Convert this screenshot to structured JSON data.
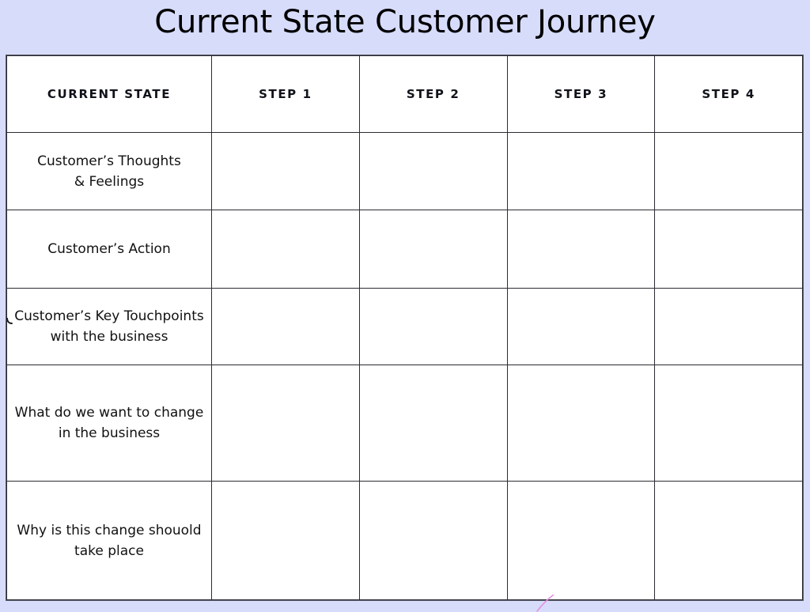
{
  "page": {
    "title": "Current State Customer Journey",
    "background_color": "#d7dcfb"
  },
  "colors": {
    "background": "#d7dcfb",
    "header_current_state": "#9ad9fb",
    "header_step": "#bdf0f0",
    "cell_background": "#ffffff",
    "border": "#2b2b33",
    "text": "#111111",
    "artifact_stroke": "#e58fe0"
  },
  "table": {
    "columns": [
      {
        "key": "label",
        "label": "CURRENT STATE",
        "type": "label"
      },
      {
        "key": "step1",
        "label": "STEP 1",
        "type": "step"
      },
      {
        "key": "step2",
        "label": "STEP 2",
        "type": "step"
      },
      {
        "key": "step3",
        "label": "STEP 3",
        "type": "step"
      },
      {
        "key": "step4",
        "label": "STEP 4",
        "type": "step"
      }
    ],
    "rows": [
      {
        "label_line1": "Customer’s Thoughts",
        "label_line2": "& Feelings",
        "cells": [
          "",
          "",
          "",
          ""
        ]
      },
      {
        "label_line1": "Customer’s Action",
        "label_line2": "",
        "cells": [
          "",
          "",
          "",
          ""
        ]
      },
      {
        "label_line1": "Customer’s Key Touchpoints",
        "label_line2": "with the business",
        "cells": [
          "",
          "",
          "",
          ""
        ]
      },
      {
        "label_line1": "What do we want to change",
        "label_line2": "in the business",
        "cells": [
          "",
          "",
          "",
          ""
        ]
      },
      {
        "label_line1": "Why is this change shouold",
        "label_line2": "take place",
        "cells": [
          "",
          "",
          "",
          ""
        ]
      }
    ]
  }
}
